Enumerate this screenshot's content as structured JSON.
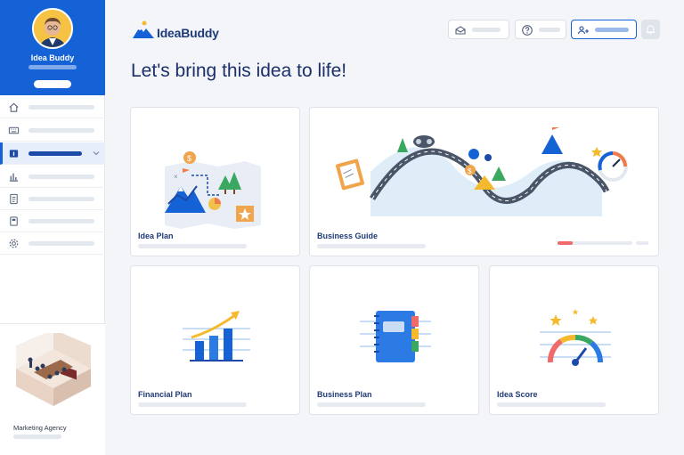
{
  "user": {
    "name": "Idea Buddy"
  },
  "sidebar": {
    "items": [
      {
        "icon": "home-icon",
        "active": false
      },
      {
        "icon": "keyboard-icon",
        "active": false
      },
      {
        "icon": "idea-info-icon",
        "active": true
      },
      {
        "icon": "bar-chart-icon",
        "active": false
      },
      {
        "icon": "document-icon",
        "active": false
      },
      {
        "icon": "book-icon",
        "active": false
      },
      {
        "icon": "gear-icon",
        "active": false
      }
    ],
    "company": "Marketing Agency"
  },
  "header": {
    "brand": "IdeaBuddy",
    "buttons": [
      {
        "icon": "mail-icon"
      },
      {
        "icon": "help-icon"
      },
      {
        "icon": "add-user-icon",
        "primary": true
      }
    ],
    "notification_icon": "bell-icon"
  },
  "main": {
    "title": "Let's bring this idea to life!",
    "cards": [
      {
        "title": "Idea Plan"
      },
      {
        "title": "Business Guide",
        "progress": 0.2
      },
      {
        "title": "Financial Plan"
      },
      {
        "title": "Business Plan"
      },
      {
        "title": "Idea Score"
      }
    ]
  },
  "colors": {
    "brand": "#1462d6",
    "accent_progress": "#f06a6a",
    "title": "#1c2f6b"
  }
}
